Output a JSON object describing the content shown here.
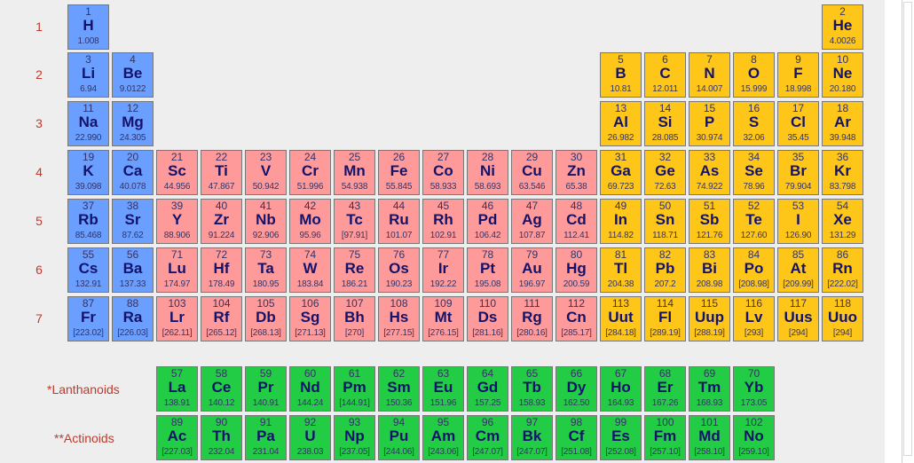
{
  "period_labels": [
    "1",
    "2",
    "3",
    "4",
    "5",
    "6",
    "7"
  ],
  "markers": {
    "lanthanoid_star": "*",
    "actinoid_star": "**"
  },
  "series_labels": {
    "lanthanoids": "*Lanthanoids",
    "actinoids": "**Actinoids"
  },
  "category_colors": {
    "s": "#6a9fff",
    "p": "#ffc61a",
    "d": "#ff9a9a",
    "f": "#22cc44"
  },
  "elements": [
    {
      "n": "1",
      "sym": "H",
      "mass": "1.008",
      "period": 1,
      "group": 1,
      "cat": "s"
    },
    {
      "n": "2",
      "sym": "He",
      "mass": "4.0026",
      "period": 1,
      "group": 18,
      "cat": "p"
    },
    {
      "n": "3",
      "sym": "Li",
      "mass": "6.94",
      "period": 2,
      "group": 1,
      "cat": "s"
    },
    {
      "n": "4",
      "sym": "Be",
      "mass": "9.0122",
      "period": 2,
      "group": 2,
      "cat": "s"
    },
    {
      "n": "5",
      "sym": "B",
      "mass": "10.81",
      "period": 2,
      "group": 13,
      "cat": "p"
    },
    {
      "n": "6",
      "sym": "C",
      "mass": "12.011",
      "period": 2,
      "group": 14,
      "cat": "p"
    },
    {
      "n": "7",
      "sym": "N",
      "mass": "14.007",
      "period": 2,
      "group": 15,
      "cat": "p"
    },
    {
      "n": "8",
      "sym": "O",
      "mass": "15.999",
      "period": 2,
      "group": 16,
      "cat": "p"
    },
    {
      "n": "9",
      "sym": "F",
      "mass": "18.998",
      "period": 2,
      "group": 17,
      "cat": "p"
    },
    {
      "n": "10",
      "sym": "Ne",
      "mass": "20.180",
      "period": 2,
      "group": 18,
      "cat": "p"
    },
    {
      "n": "11",
      "sym": "Na",
      "mass": "22.990",
      "period": 3,
      "group": 1,
      "cat": "s"
    },
    {
      "n": "12",
      "sym": "Mg",
      "mass": "24.305",
      "period": 3,
      "group": 2,
      "cat": "s"
    },
    {
      "n": "13",
      "sym": "Al",
      "mass": "26.982",
      "period": 3,
      "group": 13,
      "cat": "p"
    },
    {
      "n": "14",
      "sym": "Si",
      "mass": "28.085",
      "period": 3,
      "group": 14,
      "cat": "p"
    },
    {
      "n": "15",
      "sym": "P",
      "mass": "30.974",
      "period": 3,
      "group": 15,
      "cat": "p"
    },
    {
      "n": "16",
      "sym": "S",
      "mass": "32.06",
      "period": 3,
      "group": 16,
      "cat": "p"
    },
    {
      "n": "17",
      "sym": "Cl",
      "mass": "35.45",
      "period": 3,
      "group": 17,
      "cat": "p"
    },
    {
      "n": "18",
      "sym": "Ar",
      "mass": "39.948",
      "period": 3,
      "group": 18,
      "cat": "p"
    },
    {
      "n": "19",
      "sym": "K",
      "mass": "39.098",
      "period": 4,
      "group": 1,
      "cat": "s"
    },
    {
      "n": "20",
      "sym": "Ca",
      "mass": "40.078",
      "period": 4,
      "group": 2,
      "cat": "s"
    },
    {
      "n": "21",
      "sym": "Sc",
      "mass": "44.956",
      "period": 4,
      "group": 3,
      "cat": "d"
    },
    {
      "n": "22",
      "sym": "Ti",
      "mass": "47.867",
      "period": 4,
      "group": 4,
      "cat": "d"
    },
    {
      "n": "23",
      "sym": "V",
      "mass": "50.942",
      "period": 4,
      "group": 5,
      "cat": "d"
    },
    {
      "n": "24",
      "sym": "Cr",
      "mass": "51.996",
      "period": 4,
      "group": 6,
      "cat": "d"
    },
    {
      "n": "25",
      "sym": "Mn",
      "mass": "54.938",
      "period": 4,
      "group": 7,
      "cat": "d"
    },
    {
      "n": "26",
      "sym": "Fe",
      "mass": "55.845",
      "period": 4,
      "group": 8,
      "cat": "d"
    },
    {
      "n": "27",
      "sym": "Co",
      "mass": "58.933",
      "period": 4,
      "group": 9,
      "cat": "d"
    },
    {
      "n": "28",
      "sym": "Ni",
      "mass": "58.693",
      "period": 4,
      "group": 10,
      "cat": "d"
    },
    {
      "n": "29",
      "sym": "Cu",
      "mass": "63.546",
      "period": 4,
      "group": 11,
      "cat": "d"
    },
    {
      "n": "30",
      "sym": "Zn",
      "mass": "65.38",
      "period": 4,
      "group": 12,
      "cat": "d"
    },
    {
      "n": "31",
      "sym": "Ga",
      "mass": "69.723",
      "period": 4,
      "group": 13,
      "cat": "p"
    },
    {
      "n": "32",
      "sym": "Ge",
      "mass": "72.63",
      "period": 4,
      "group": 14,
      "cat": "p"
    },
    {
      "n": "33",
      "sym": "As",
      "mass": "74.922",
      "period": 4,
      "group": 15,
      "cat": "p"
    },
    {
      "n": "34",
      "sym": "Se",
      "mass": "78.96",
      "period": 4,
      "group": 16,
      "cat": "p"
    },
    {
      "n": "35",
      "sym": "Br",
      "mass": "79.904",
      "period": 4,
      "group": 17,
      "cat": "p"
    },
    {
      "n": "36",
      "sym": "Kr",
      "mass": "83.798",
      "period": 4,
      "group": 18,
      "cat": "p"
    },
    {
      "n": "37",
      "sym": "Rb",
      "mass": "85.468",
      "period": 5,
      "group": 1,
      "cat": "s"
    },
    {
      "n": "38",
      "sym": "Sr",
      "mass": "87.62",
      "period": 5,
      "group": 2,
      "cat": "s"
    },
    {
      "n": "39",
      "sym": "Y",
      "mass": "88.906",
      "period": 5,
      "group": 3,
      "cat": "d"
    },
    {
      "n": "40",
      "sym": "Zr",
      "mass": "91.224",
      "period": 5,
      "group": 4,
      "cat": "d"
    },
    {
      "n": "41",
      "sym": "Nb",
      "mass": "92.906",
      "period": 5,
      "group": 5,
      "cat": "d"
    },
    {
      "n": "42",
      "sym": "Mo",
      "mass": "95.96",
      "period": 5,
      "group": 6,
      "cat": "d"
    },
    {
      "n": "43",
      "sym": "Tc",
      "mass": "[97.91]",
      "period": 5,
      "group": 7,
      "cat": "d"
    },
    {
      "n": "44",
      "sym": "Ru",
      "mass": "101.07",
      "period": 5,
      "group": 8,
      "cat": "d"
    },
    {
      "n": "45",
      "sym": "Rh",
      "mass": "102.91",
      "period": 5,
      "group": 9,
      "cat": "d"
    },
    {
      "n": "46",
      "sym": "Pd",
      "mass": "106.42",
      "period": 5,
      "group": 10,
      "cat": "d"
    },
    {
      "n": "47",
      "sym": "Ag",
      "mass": "107.87",
      "period": 5,
      "group": 11,
      "cat": "d"
    },
    {
      "n": "48",
      "sym": "Cd",
      "mass": "112.41",
      "period": 5,
      "group": 12,
      "cat": "d"
    },
    {
      "n": "49",
      "sym": "In",
      "mass": "114.82",
      "period": 5,
      "group": 13,
      "cat": "p"
    },
    {
      "n": "50",
      "sym": "Sn",
      "mass": "118.71",
      "period": 5,
      "group": 14,
      "cat": "p"
    },
    {
      "n": "51",
      "sym": "Sb",
      "mass": "121.76",
      "period": 5,
      "group": 15,
      "cat": "p"
    },
    {
      "n": "52",
      "sym": "Te",
      "mass": "127.60",
      "period": 5,
      "group": 16,
      "cat": "p"
    },
    {
      "n": "53",
      "sym": "I",
      "mass": "126.90",
      "period": 5,
      "group": 17,
      "cat": "p"
    },
    {
      "n": "54",
      "sym": "Xe",
      "mass": "131.29",
      "period": 5,
      "group": 18,
      "cat": "p"
    },
    {
      "n": "55",
      "sym": "Cs",
      "mass": "132.91",
      "period": 6,
      "group": 1,
      "cat": "s"
    },
    {
      "n": "56",
      "sym": "Ba",
      "mass": "137.33",
      "period": 6,
      "group": 2,
      "cat": "s"
    },
    {
      "n": "71",
      "sym": "Lu",
      "mass": "174.97",
      "period": 6,
      "group": 3,
      "cat": "d"
    },
    {
      "n": "72",
      "sym": "Hf",
      "mass": "178.49",
      "period": 6,
      "group": 4,
      "cat": "d"
    },
    {
      "n": "73",
      "sym": "Ta",
      "mass": "180.95",
      "period": 6,
      "group": 5,
      "cat": "d"
    },
    {
      "n": "74",
      "sym": "W",
      "mass": "183.84",
      "period": 6,
      "group": 6,
      "cat": "d"
    },
    {
      "n": "75",
      "sym": "Re",
      "mass": "186.21",
      "period": 6,
      "group": 7,
      "cat": "d"
    },
    {
      "n": "76",
      "sym": "Os",
      "mass": "190.23",
      "period": 6,
      "group": 8,
      "cat": "d"
    },
    {
      "n": "77",
      "sym": "Ir",
      "mass": "192.22",
      "period": 6,
      "group": 9,
      "cat": "d"
    },
    {
      "n": "78",
      "sym": "Pt",
      "mass": "195.08",
      "period": 6,
      "group": 10,
      "cat": "d"
    },
    {
      "n": "79",
      "sym": "Au",
      "mass": "196.97",
      "period": 6,
      "group": 11,
      "cat": "d"
    },
    {
      "n": "80",
      "sym": "Hg",
      "mass": "200.59",
      "period": 6,
      "group": 12,
      "cat": "d"
    },
    {
      "n": "81",
      "sym": "Tl",
      "mass": "204.38",
      "period": 6,
      "group": 13,
      "cat": "p"
    },
    {
      "n": "82",
      "sym": "Pb",
      "mass": "207.2",
      "period": 6,
      "group": 14,
      "cat": "p"
    },
    {
      "n": "83",
      "sym": "Bi",
      "mass": "208.98",
      "period": 6,
      "group": 15,
      "cat": "p"
    },
    {
      "n": "84",
      "sym": "Po",
      "mass": "[208.98]",
      "period": 6,
      "group": 16,
      "cat": "p"
    },
    {
      "n": "85",
      "sym": "At",
      "mass": "[209.99]",
      "period": 6,
      "group": 17,
      "cat": "p"
    },
    {
      "n": "86",
      "sym": "Rn",
      "mass": "[222.02]",
      "period": 6,
      "group": 18,
      "cat": "p"
    },
    {
      "n": "87",
      "sym": "Fr",
      "mass": "[223.02]",
      "period": 7,
      "group": 1,
      "cat": "s"
    },
    {
      "n": "88",
      "sym": "Ra",
      "mass": "[226.03]",
      "period": 7,
      "group": 2,
      "cat": "s"
    },
    {
      "n": "103",
      "sym": "Lr",
      "mass": "[262.11]",
      "period": 7,
      "group": 3,
      "cat": "d"
    },
    {
      "n": "104",
      "sym": "Rf",
      "mass": "[265.12]",
      "period": 7,
      "group": 4,
      "cat": "d"
    },
    {
      "n": "105",
      "sym": "Db",
      "mass": "[268.13]",
      "period": 7,
      "group": 5,
      "cat": "d"
    },
    {
      "n": "106",
      "sym": "Sg",
      "mass": "[271.13]",
      "period": 7,
      "group": 6,
      "cat": "d"
    },
    {
      "n": "107",
      "sym": "Bh",
      "mass": "[270]",
      "period": 7,
      "group": 7,
      "cat": "d"
    },
    {
      "n": "108",
      "sym": "Hs",
      "mass": "[277.15]",
      "period": 7,
      "group": 8,
      "cat": "d"
    },
    {
      "n": "109",
      "sym": "Mt",
      "mass": "[276.15]",
      "period": 7,
      "group": 9,
      "cat": "d"
    },
    {
      "n": "110",
      "sym": "Ds",
      "mass": "[281.16]",
      "period": 7,
      "group": 10,
      "cat": "d"
    },
    {
      "n": "111",
      "sym": "Rg",
      "mass": "[280.16]",
      "period": 7,
      "group": 11,
      "cat": "d"
    },
    {
      "n": "112",
      "sym": "Cn",
      "mass": "[285.17]",
      "period": 7,
      "group": 12,
      "cat": "d"
    },
    {
      "n": "113",
      "sym": "Uut",
      "mass": "[284.18]",
      "period": 7,
      "group": 13,
      "cat": "p"
    },
    {
      "n": "114",
      "sym": "Fl",
      "mass": "[289.19]",
      "period": 7,
      "group": 14,
      "cat": "p"
    },
    {
      "n": "115",
      "sym": "Uup",
      "mass": "[288.19]",
      "period": 7,
      "group": 15,
      "cat": "p"
    },
    {
      "n": "116",
      "sym": "Lv",
      "mass": "[293]",
      "period": 7,
      "group": 16,
      "cat": "p"
    },
    {
      "n": "117",
      "sym": "Uus",
      "mass": "[294]",
      "period": 7,
      "group": 17,
      "cat": "p"
    },
    {
      "n": "118",
      "sym": "Uuo",
      "mass": "[294]",
      "period": 7,
      "group": 18,
      "cat": "p"
    },
    {
      "n": "57",
      "sym": "La",
      "mass": "138.91",
      "period": "lanthanoid",
      "group": 3,
      "cat": "f"
    },
    {
      "n": "58",
      "sym": "Ce",
      "mass": "140.12",
      "period": "lanthanoid",
      "group": 4,
      "cat": "f"
    },
    {
      "n": "59",
      "sym": "Pr",
      "mass": "140.91",
      "period": "lanthanoid",
      "group": 5,
      "cat": "f"
    },
    {
      "n": "60",
      "sym": "Nd",
      "mass": "144.24",
      "period": "lanthanoid",
      "group": 6,
      "cat": "f"
    },
    {
      "n": "61",
      "sym": "Pm",
      "mass": "[144.91]",
      "period": "lanthanoid",
      "group": 7,
      "cat": "f"
    },
    {
      "n": "62",
      "sym": "Sm",
      "mass": "150.36",
      "period": "lanthanoid",
      "group": 8,
      "cat": "f"
    },
    {
      "n": "63",
      "sym": "Eu",
      "mass": "151.96",
      "period": "lanthanoid",
      "group": 9,
      "cat": "f"
    },
    {
      "n": "64",
      "sym": "Gd",
      "mass": "157.25",
      "period": "lanthanoid",
      "group": 10,
      "cat": "f"
    },
    {
      "n": "65",
      "sym": "Tb",
      "mass": "158.93",
      "period": "lanthanoid",
      "group": 11,
      "cat": "f"
    },
    {
      "n": "66",
      "sym": "Dy",
      "mass": "162.50",
      "period": "lanthanoid",
      "group": 12,
      "cat": "f"
    },
    {
      "n": "67",
      "sym": "Ho",
      "mass": "164.93",
      "period": "lanthanoid",
      "group": 13,
      "cat": "f"
    },
    {
      "n": "68",
      "sym": "Er",
      "mass": "167.26",
      "period": "lanthanoid",
      "group": 14,
      "cat": "f"
    },
    {
      "n": "69",
      "sym": "Tm",
      "mass": "168.93",
      "period": "lanthanoid",
      "group": 15,
      "cat": "f"
    },
    {
      "n": "70",
      "sym": "Yb",
      "mass": "173.05",
      "period": "lanthanoid",
      "group": 16,
      "cat": "f"
    },
    {
      "n": "89",
      "sym": "Ac",
      "mass": "[227.03]",
      "period": "actinoid",
      "group": 3,
      "cat": "f"
    },
    {
      "n": "90",
      "sym": "Th",
      "mass": "232.04",
      "period": "actinoid",
      "group": 4,
      "cat": "f"
    },
    {
      "n": "91",
      "sym": "Pa",
      "mass": "231.04",
      "period": "actinoid",
      "group": 5,
      "cat": "f"
    },
    {
      "n": "92",
      "sym": "U",
      "mass": "238.03",
      "period": "actinoid",
      "group": 6,
      "cat": "f"
    },
    {
      "n": "93",
      "sym": "Np",
      "mass": "[237.05]",
      "period": "actinoid",
      "group": 7,
      "cat": "f"
    },
    {
      "n": "94",
      "sym": "Pu",
      "mass": "[244.06]",
      "period": "actinoid",
      "group": 8,
      "cat": "f"
    },
    {
      "n": "95",
      "sym": "Am",
      "mass": "[243.06]",
      "period": "actinoid",
      "group": 9,
      "cat": "f"
    },
    {
      "n": "96",
      "sym": "Cm",
      "mass": "[247.07]",
      "period": "actinoid",
      "group": 10,
      "cat": "f"
    },
    {
      "n": "97",
      "sym": "Bk",
      "mass": "[247.07]",
      "period": "actinoid",
      "group": 11,
      "cat": "f"
    },
    {
      "n": "98",
      "sym": "Cf",
      "mass": "[251.08]",
      "period": "actinoid",
      "group": 12,
      "cat": "f"
    },
    {
      "n": "99",
      "sym": "Es",
      "mass": "[252.08]",
      "period": "actinoid",
      "group": 13,
      "cat": "f"
    },
    {
      "n": "100",
      "sym": "Fm",
      "mass": "[257.10]",
      "period": "actinoid",
      "group": 14,
      "cat": "f"
    },
    {
      "n": "101",
      "sym": "Md",
      "mass": "[258.10]",
      "period": "actinoid",
      "group": 15,
      "cat": "f"
    },
    {
      "n": "102",
      "sym": "No",
      "mass": "[259.10]",
      "period": "actinoid",
      "group": 16,
      "cat": "f"
    }
  ]
}
